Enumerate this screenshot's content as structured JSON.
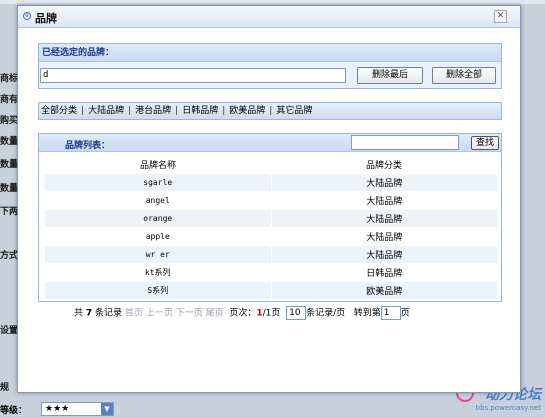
{
  "background": {
    "labels": [
      "商标",
      "商有",
      "购买",
      "数量",
      "数量",
      "数量",
      "下两",
      "方式",
      "设置",
      "规"
    ],
    "rating_label": "等级：",
    "rating_value": "★★★"
  },
  "watermark": {
    "logo_text": "动力论坛",
    "url": "bbs.poweroasy.net"
  },
  "dialog": {
    "title": "品牌",
    "selected": {
      "header": "已经选定的品牌：",
      "value": "d",
      "remove_last_label": "删除最后",
      "remove_all_label": "删除全部"
    },
    "categories": [
      "全部分类",
      "大陆品牌",
      "港台品牌",
      "日韩品牌",
      "欧美品牌",
      "其它品牌"
    ],
    "list": {
      "header": "品牌列表：",
      "search_placeholder": "",
      "search_label": "查找",
      "columns": [
        "品牌名称",
        "品牌分类"
      ],
      "rows": [
        {
          "name": "sgarle",
          "category": "大陆品牌"
        },
        {
          "name": "angel",
          "category": "大陆品牌"
        },
        {
          "name": "orange",
          "category": "大陆品牌"
        },
        {
          "name": "apple",
          "category": "大陆品牌"
        },
        {
          "name": "wr er",
          "category": "大陆品牌"
        },
        {
          "name": "kt系列",
          "category": "日韩品牌"
        },
        {
          "name": "S系列",
          "category": "欧美品牌"
        }
      ]
    },
    "pager": {
      "total_prefix": "共",
      "total": "7",
      "total_suffix": "条记录",
      "first": "首页",
      "prev": "上一页",
      "next": "下一页",
      "last": "尾页",
      "page_label": "页次：",
      "current": "1",
      "pages": "/1页",
      "per_page": "10",
      "per_page_suffix": "条记录/页",
      "goto_label": "转到第",
      "goto_value": "1",
      "goto_suffix": "页"
    }
  }
}
